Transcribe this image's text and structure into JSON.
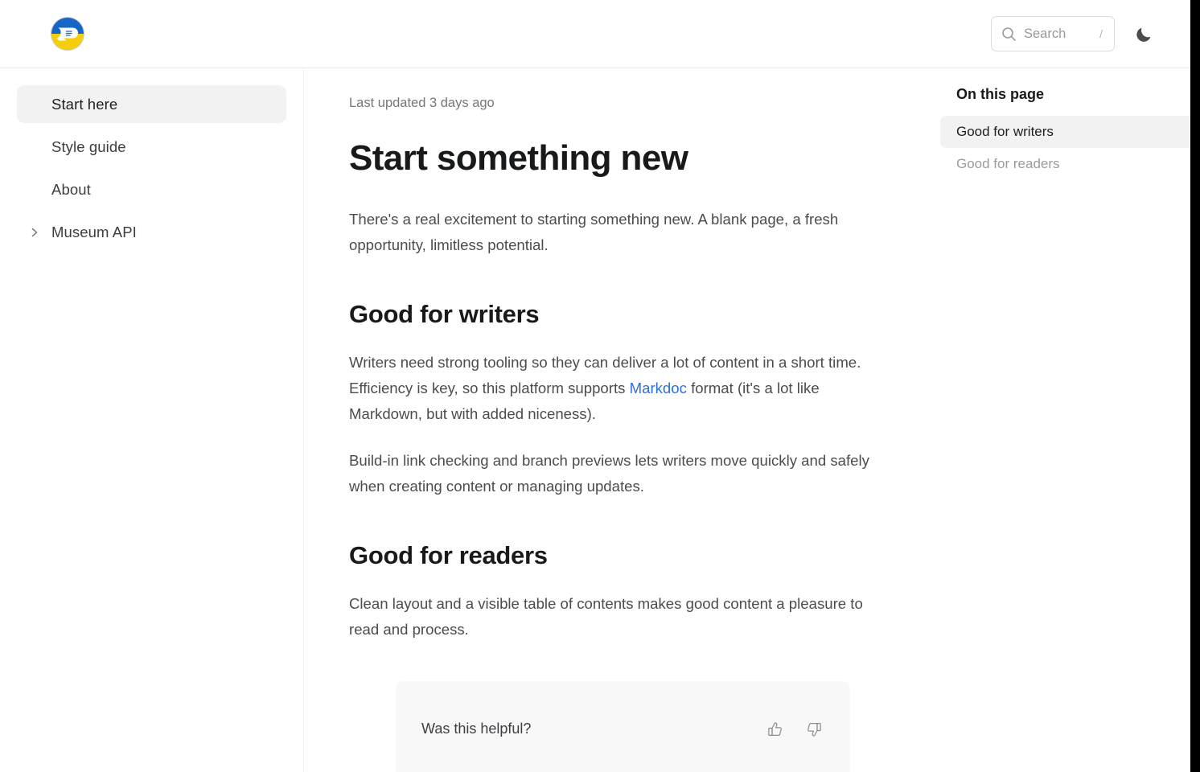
{
  "header": {
    "logo_name": "docs-logo",
    "logo_colors": {
      "top": "#1666c8",
      "bottom": "#f5cf0b",
      "mark": "#ffffff"
    },
    "search": {
      "placeholder": "Search",
      "value": "",
      "shortcut_hint": "/",
      "icon": "search-icon"
    },
    "theme_toggle": {
      "icon": "moon-icon",
      "label": "Toggle dark mode",
      "color": "#4a4c50"
    }
  },
  "sidebar": {
    "items": [
      {
        "label": "Start here",
        "active": true,
        "expandable": false
      },
      {
        "label": "Style guide",
        "active": false,
        "expandable": false
      },
      {
        "label": "About",
        "active": false,
        "expandable": false
      },
      {
        "label": "Museum API",
        "active": false,
        "expandable": true
      }
    ]
  },
  "main": {
    "last_updated": "Last updated 3 days ago",
    "title": "Start something new",
    "intro": "There's a real excitement to starting something new. A blank page, a fresh opportunity, limitless potential.",
    "sections": [
      {
        "heading": "Good for writers",
        "paragraph_1_before_link": "Writers need strong tooling so they can deliver a lot of content in a short time. Efficiency is key, so this platform supports ",
        "link_text": "Markdoc",
        "paragraph_1_after_link": " format (it's a lot like Markdown, but with added niceness).",
        "paragraph_2": "Build-in link checking and branch previews lets writers move quickly and safely when creating content or managing updates."
      },
      {
        "heading": "Good for readers",
        "paragraph_1": "Clean layout and a visible table of contents makes good content a pleasure to read and process."
      }
    ],
    "feedback": {
      "question": "Was this helpful?",
      "thumbs_up_icon": "thumbs-up-icon",
      "thumbs_down_icon": "thumbs-down-icon"
    }
  },
  "toc": {
    "title": "On this page",
    "items": [
      {
        "label": "Good for writers",
        "active": true
      },
      {
        "label": "Good for readers",
        "active": false
      }
    ]
  },
  "colors": {
    "link": "#2f6fdd",
    "active_bg": "#f2f2f3",
    "card_bg": "#f8f8f9",
    "text": "#4a4c50",
    "heading": "#17191b",
    "muted": "#9a9c9f"
  }
}
